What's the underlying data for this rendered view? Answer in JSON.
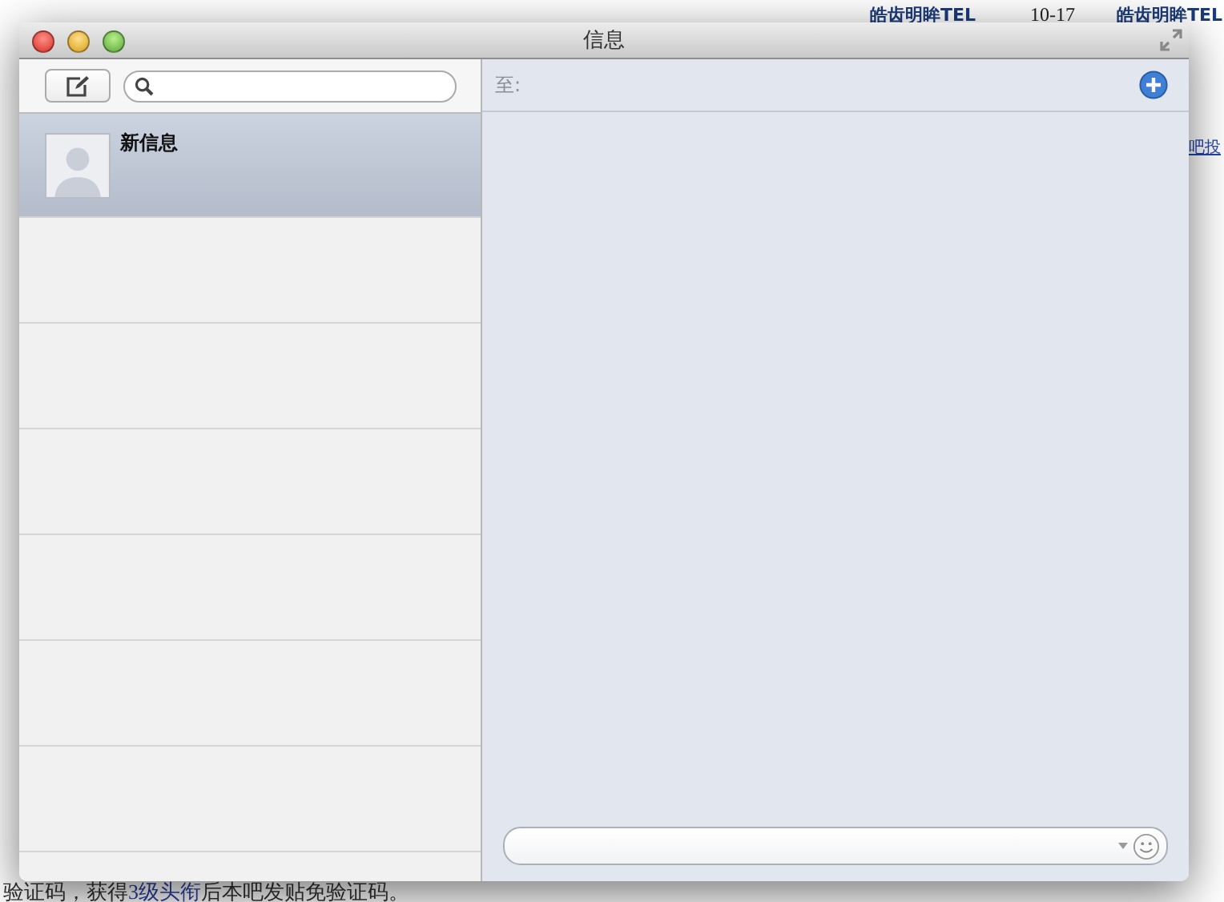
{
  "background_page": {
    "header_items": [
      {
        "text": "皓齿明眸TEL",
        "kind": "user"
      },
      {
        "text": "10-17",
        "kind": "date"
      },
      {
        "text": "皓齿明眸TEL",
        "kind": "user"
      }
    ],
    "side_link": "吧投",
    "notice": {
      "before": "验证码，获得",
      "link": "3级头衔",
      "after": "后本吧发贴免验证码。"
    }
  },
  "window": {
    "title": "信息"
  },
  "sidebar": {
    "conversations": [
      {
        "name": "新信息",
        "selected": true
      }
    ]
  },
  "recipient": {
    "label": "至:"
  }
}
